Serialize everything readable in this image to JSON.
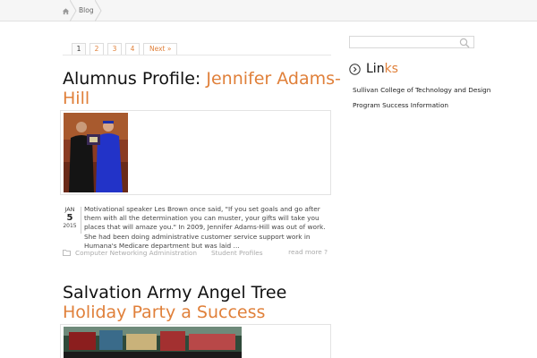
{
  "breadcrumb": {
    "items": [
      "Blog"
    ]
  },
  "pagination": {
    "pages": [
      "1",
      "2",
      "3",
      "4"
    ],
    "current": "1",
    "next_label": "Next »"
  },
  "posts": [
    {
      "title_plain": "Alumnus Profile: ",
      "title_accent_line1": "Jennifer Adams-",
      "title_accent_line2": "Hill",
      "date": {
        "month": "JAN",
        "day": "5",
        "year": "2015"
      },
      "excerpt": "Motivational speaker Les Brown once said, \"If you set goals and go after them with all the determination you can muster, your gifts will take you places that will amaze you.\" In 2009, Jennifer Adams-Hill was out of work. She had been doing administrative customer service support work in Humana's Medicare department but was laid …",
      "categories": [
        "Computer Networking Administration",
        "Student Profiles"
      ],
      "read_more": "read more ?"
    },
    {
      "title_line1": "Salvation Army Angel Tree",
      "title_accent_line2": "Holiday Party a Success"
    }
  ],
  "sidebar": {
    "search": {
      "placeholder": ""
    },
    "links_title_plain": "Lin",
    "links_title_accent": "ks",
    "links": [
      "Sullivan College of Technology and Design",
      "Program Success Information"
    ]
  },
  "colors": {
    "accent": "#e0803a",
    "text": "#333333",
    "muted": "#aaaaaa"
  }
}
